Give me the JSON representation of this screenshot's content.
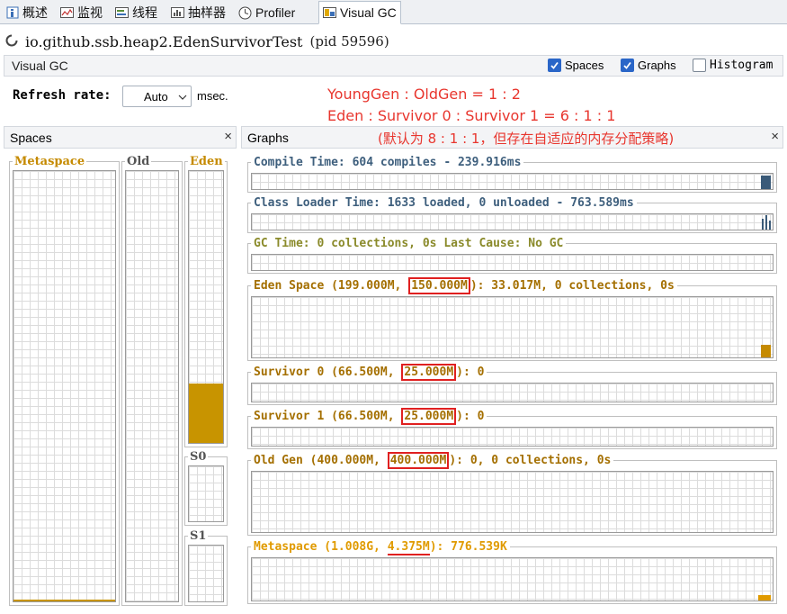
{
  "tabs": [
    {
      "label": "概述",
      "icon": "overview-icon"
    },
    {
      "label": "监视",
      "icon": "monitor-icon"
    },
    {
      "label": "线程",
      "icon": "threads-icon"
    },
    {
      "label": "抽样器",
      "icon": "sampler-icon"
    },
    {
      "label": "Profiler",
      "icon": "profiler-icon"
    },
    {
      "label": "Visual GC",
      "icon": "visualgc-icon"
    }
  ],
  "app": {
    "title": "io.github.ssb.heap2.EdenSurvivorTest",
    "pid": "(pid 59596)"
  },
  "vgc": {
    "label": "Visual GC",
    "spaces_label": "Spaces",
    "spaces_checked": true,
    "graphs_label": "Graphs",
    "graphs_checked": true,
    "histogram_label": "Histogram",
    "histogram_checked": false
  },
  "refresh": {
    "label": "Refresh rate:",
    "value": "Auto",
    "unit": "msec."
  },
  "annotations": {
    "line1": "YoungGen : OldGen = 1 : 2",
    "line2": "Eden : Survivor 0 : Survivor 1 = 6 : 1 : 1",
    "line3": "(默认为 8 : 1 : 1，但存在自适应的内存分配策略)"
  },
  "spaces_panel": {
    "title": "Spaces",
    "close": "×",
    "metaspace": "Metaspace",
    "old": "Old",
    "eden": "Eden",
    "s0": "S0",
    "s1": "S1",
    "eden_fill": 0.22,
    "metaspace_fill": 0.005
  },
  "graphs_panel": {
    "title": "Graphs",
    "close": "×",
    "compile": {
      "text": "Compile Time: 604 compiles - 239.916ms"
    },
    "classloader": {
      "text": "Class Loader Time: 1633 loaded, 0 unloaded - 763.589ms"
    },
    "gctime": {
      "text": "GC Time: 0 collections, 0s Last Cause: No GC"
    },
    "eden": {
      "pre": "Eden Space (199.000M, ",
      "hl": "150.000M",
      "post": "): 33.017M, 0 collections, 0s"
    },
    "survivor0": {
      "pre": "Survivor 0 (66.500M, ",
      "hl": "25.000M",
      "post": "): 0"
    },
    "survivor1": {
      "pre": "Survivor 1 (66.500M, ",
      "hl": "25.000M",
      "post": "): 0"
    },
    "oldgen": {
      "pre": "Old Gen (400.000M, ",
      "hl": "400.000M",
      "post": "): 0, 0 collections, 0s"
    },
    "metaspace": {
      "pre": "Metaspace (1.008G, ",
      "hl": "4.375M",
      "post": "): 776.539K"
    }
  },
  "colors": {
    "accent_gold": "#c58a00",
    "highlight_red": "#e02020",
    "annotation_red": "#e8362e"
  }
}
